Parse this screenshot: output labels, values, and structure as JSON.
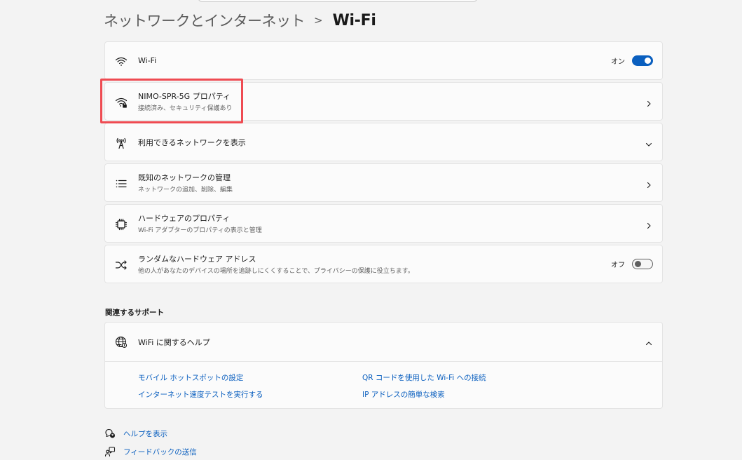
{
  "breadcrumb": {
    "parent": "ネットワークとインターネット",
    "separator": ">",
    "current": "Wi-Fi"
  },
  "rows": [
    {
      "title": "Wi-Fi",
      "icon": "wifi-icon",
      "toggle_label": "オン",
      "toggle_state": "on"
    },
    {
      "title": "NIMO-SPR-5G プロパティ",
      "subtitle": "接続済み、セキュリティ保護あり",
      "icon": "wifi-lock-icon"
    },
    {
      "title": "利用できるネットワークを表示",
      "icon": "antenna-icon"
    },
    {
      "title": "既知のネットワークの管理",
      "subtitle": "ネットワークの追加、削除、編集",
      "icon": "list-icon"
    },
    {
      "title": "ハードウェアのプロパティ",
      "subtitle": "Wi-Fi アダプターのプロパティの表示と管理",
      "icon": "chip-icon"
    },
    {
      "title": "ランダムなハードウェア アドレス",
      "subtitle": "他の人があなたのデバイスの場所を追跡しにくくすることで、プライバシーの保護に役立ちます。",
      "icon": "shuffle-icon",
      "toggle_label": "オフ",
      "toggle_state": "off"
    }
  ],
  "related": {
    "title": "関連するサポート",
    "help_title": "WiFi に関するヘルプ",
    "links": [
      "モバイル ホットスポットの設定",
      "インターネット速度テストを実行する",
      "QR コードを使用した Wi-Fi への接続",
      "IP アドレスの簡単な検索"
    ]
  },
  "footer": {
    "help": "ヘルプを表示",
    "feedback": "フィードバックの送信"
  },
  "colors": {
    "accent": "#0a5fbf",
    "highlight": "#ef4b52",
    "background": "#f3f3f3",
    "card": "#fbfbfb"
  }
}
